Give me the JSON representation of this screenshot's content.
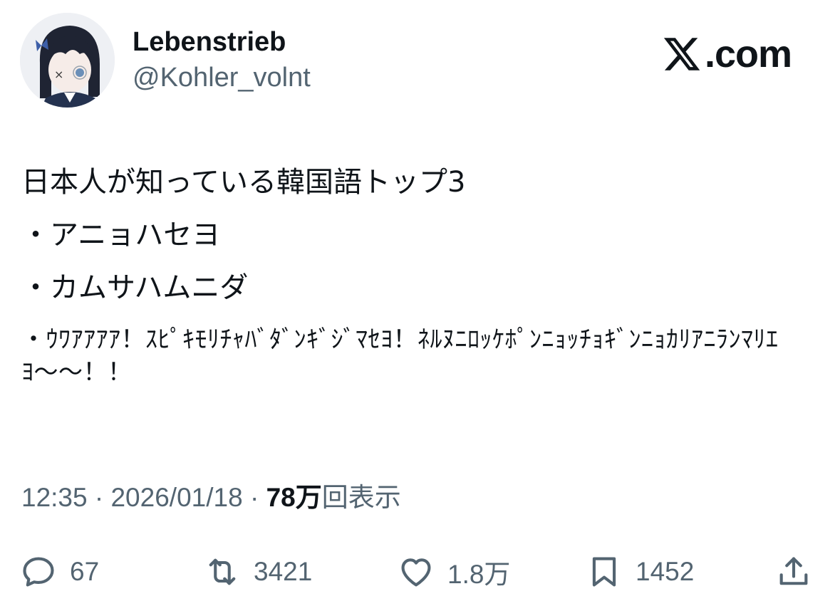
{
  "user": {
    "display_name": "Lebenstrieb",
    "handle": "@Kohler_volnt"
  },
  "brand": {
    "text": ".com",
    "icon": "x-logo-icon"
  },
  "tweet": {
    "lines": [
      "日本人が知っている韓国語トップ3",
      "・アニョハセヨ",
      "・カムサハムニダ",
      "・ｳﾜｱｱｱｱ！ｽﾋﾟｷﾓﾘﾁｬﾊﾞﾀﾞﾝｷﾞｼﾞﾏｾﾖ！ﾈﾙﾇﾆﾛｯｹﾎﾟﾝﾆｮｯﾁｮｷﾞﾝﾆｮｶﾘｱﾆﾗﾝﾏﾘｴﾖ〜〜！！"
    ]
  },
  "meta": {
    "time": "12:35",
    "sep1": " · ",
    "date": "2026/01/18",
    "sep2": " · ",
    "views_count": "78万",
    "views_label": "回表示"
  },
  "actions": {
    "reply": {
      "icon": "reply-icon",
      "count": "67"
    },
    "repost": {
      "icon": "repost-icon",
      "count": "3421"
    },
    "like": {
      "icon": "heart-icon",
      "count": "1.8万"
    },
    "bookmark": {
      "icon": "bookmark-icon",
      "count": "1452"
    },
    "share": {
      "icon": "share-icon"
    }
  },
  "colors": {
    "text_primary": "#0f1419",
    "text_secondary": "#536471"
  }
}
